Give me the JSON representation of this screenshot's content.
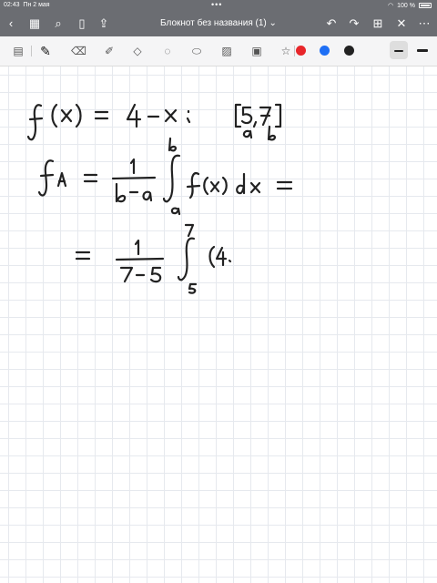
{
  "status": {
    "time": "02:43",
    "date": "Пн 2 мая",
    "battery": "100 %"
  },
  "document": {
    "title": "Блокнот без названия (1)"
  },
  "colors": {
    "chrome": "#6b6d72",
    "red": "#e8262a",
    "blue": "#1e6ff5",
    "black": "#222222"
  },
  "toolbar": {
    "tools": [
      "panel-icon",
      "pen-icon",
      "eraser-icon",
      "highlighter-icon",
      "shapes-icon",
      "lasso-icon",
      "tape-icon",
      "image-icon",
      "text-icon",
      "sticker-icon",
      "link-icon"
    ]
  }
}
